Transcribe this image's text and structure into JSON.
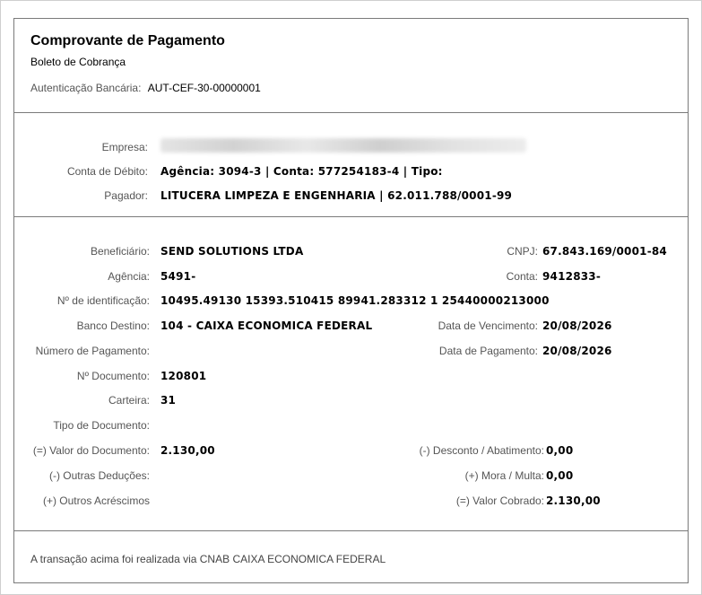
{
  "header": {
    "title": "Comprovante de Pagamento",
    "subtitle": "Boleto de Cobrança",
    "auth_label": "Autenticação Bancária:",
    "auth_value": "AUT-CEF-30-00000001"
  },
  "payer": {
    "empresa_label": "Empresa:",
    "conta_label": "Conta de Débito:",
    "conta_value": "Agência: 3094-3  |  Conta: 577254183-4  |  Tipo:",
    "pagador_label": "Pagador:",
    "pagador_value": "LITUCERA LIMPEZA E ENGENHARIA  |  62.011.788/0001-99"
  },
  "details": {
    "beneficiario_label": "Beneficiário:",
    "beneficiario_value": "SEND SOLUTIONS LTDA",
    "cnpj_label": "CNPJ:",
    "cnpj_value": "67.843.169/0001-84",
    "agencia_label": "Agência:",
    "agencia_value": "5491-",
    "conta_label": "Conta:",
    "conta_value": "9412833-",
    "ident_label": "Nº de identificação:",
    "ident_value": "10495.49130 15393.510415 89941.283312 1 25440000213000",
    "banco_label": "Banco Destino:",
    "banco_value": "104 - CAIXA ECONOMICA FEDERAL",
    "vencimento_label": "Data de Vencimento:",
    "vencimento_value": "20/08/2026",
    "num_pagamento_label": "Número de Pagamento:",
    "data_pagamento_label": "Data de Pagamento:",
    "data_pagamento_value": "20/08/2026",
    "documento_label": "Nº Documento:",
    "documento_value": "120801",
    "carteira_label": "Carteira:",
    "carteira_value": "31",
    "tipo_doc_label": "Tipo de Documento:",
    "valor_doc_label": "(=) Valor do Documento:",
    "valor_doc_value": "2.130,00",
    "desconto_label": "(-) Desconto / Abatimento:",
    "desconto_value": "0,00",
    "outras_deducoes_label": "(-) Outras Deduções:",
    "mora_label": "(+) Mora / Multa:",
    "mora_value": "0,00",
    "outros_acrescimos_label": "(+) Outros Acréscimos",
    "valor_cobrado_label": "(=) Valor Cobrado:",
    "valor_cobrado_value": "2.130,00"
  },
  "footer": {
    "text": "A transação acima foi realizada via CNAB CAIXA ECONOMICA FEDERAL"
  }
}
